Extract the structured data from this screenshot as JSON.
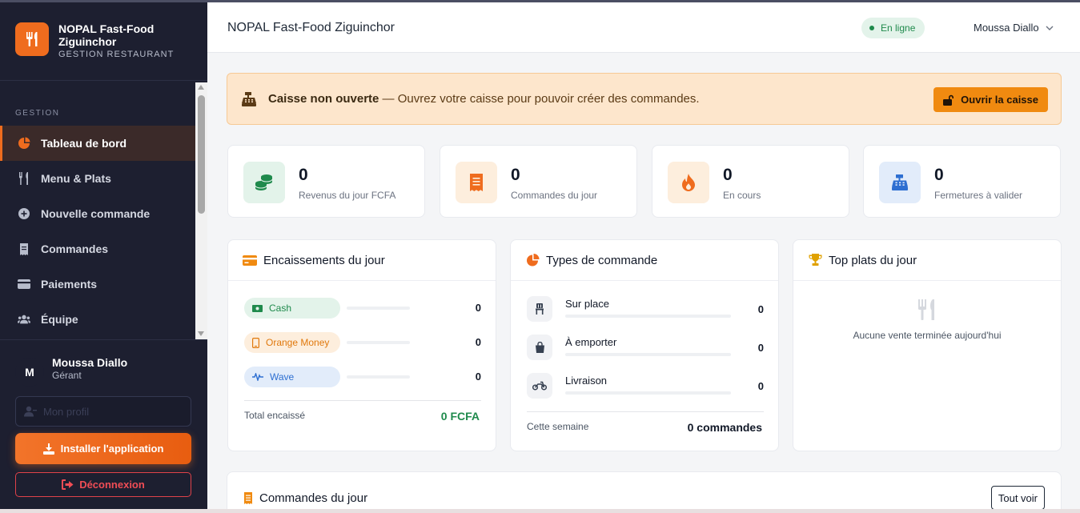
{
  "brand": {
    "name": "NOPAL Fast-Food Ziguinchor",
    "subtitle": "GESTION RESTAURANT"
  },
  "sidebar": {
    "section": "GESTION",
    "items": [
      {
        "label": "Tableau de bord",
        "icon": "pie-chart-icon",
        "active": true
      },
      {
        "label": "Menu & Plats",
        "icon": "utensils-icon"
      },
      {
        "label": "Nouvelle commande",
        "icon": "plus-circle-icon"
      },
      {
        "label": "Commandes",
        "icon": "receipt-icon"
      },
      {
        "label": "Paiements",
        "icon": "credit-card-icon"
      },
      {
        "label": "Équipe",
        "icon": "users-icon"
      }
    ]
  },
  "user": {
    "initial": "M",
    "name": "Moussa Diallo",
    "role": "Gérant"
  },
  "sidebar_actions": {
    "profile": "Mon profil",
    "install": "Installer l'application",
    "logout": "Déconnexion"
  },
  "header": {
    "title": "NOPAL Fast-Food Ziguinchor",
    "status": "En ligne",
    "user": "Moussa Diallo"
  },
  "alert": {
    "title": "Caisse non ouverte",
    "message": " — Ouvrez votre caisse pour pouvoir créer des commandes.",
    "button": "Ouvrir la caisse"
  },
  "stats": [
    {
      "value": "0",
      "label": "Revenus du jour FCFA",
      "icon": "coins-icon"
    },
    {
      "value": "0",
      "label": "Commandes du jour",
      "icon": "receipt-icon"
    },
    {
      "value": "0",
      "label": "En cours",
      "icon": "fire-icon"
    },
    {
      "value": "0",
      "label": "Fermetures à valider",
      "icon": "cash-register-icon"
    }
  ],
  "encaissements": {
    "title": "Encaissements du jour",
    "rows": [
      {
        "label": "Cash",
        "value": "0",
        "level": 0
      },
      {
        "label": "Orange Money",
        "value": "0",
        "level": 0
      },
      {
        "label": "Wave",
        "value": "0",
        "level": 0
      }
    ],
    "total_label": "Total encaissé",
    "total_value": "0 FCFA"
  },
  "types": {
    "title": "Types de commande",
    "rows": [
      {
        "label": "Sur place",
        "value": "0",
        "level": 0
      },
      {
        "label": "À emporter",
        "value": "0",
        "level": 0
      },
      {
        "label": "Livraison",
        "value": "0",
        "level": 0
      }
    ],
    "footer_label": "Cette semaine",
    "footer_value": "0 commandes"
  },
  "top_plats": {
    "title": "Top plats du jour",
    "empty": "Aucune vente terminée aujourd'hui"
  },
  "commandes": {
    "title": "Commandes du jour",
    "button": "Tout voir"
  },
  "colors": {
    "accent": "#ef6c1e",
    "sidebar": "#1d1f30",
    "success": "#1f8a4c"
  }
}
